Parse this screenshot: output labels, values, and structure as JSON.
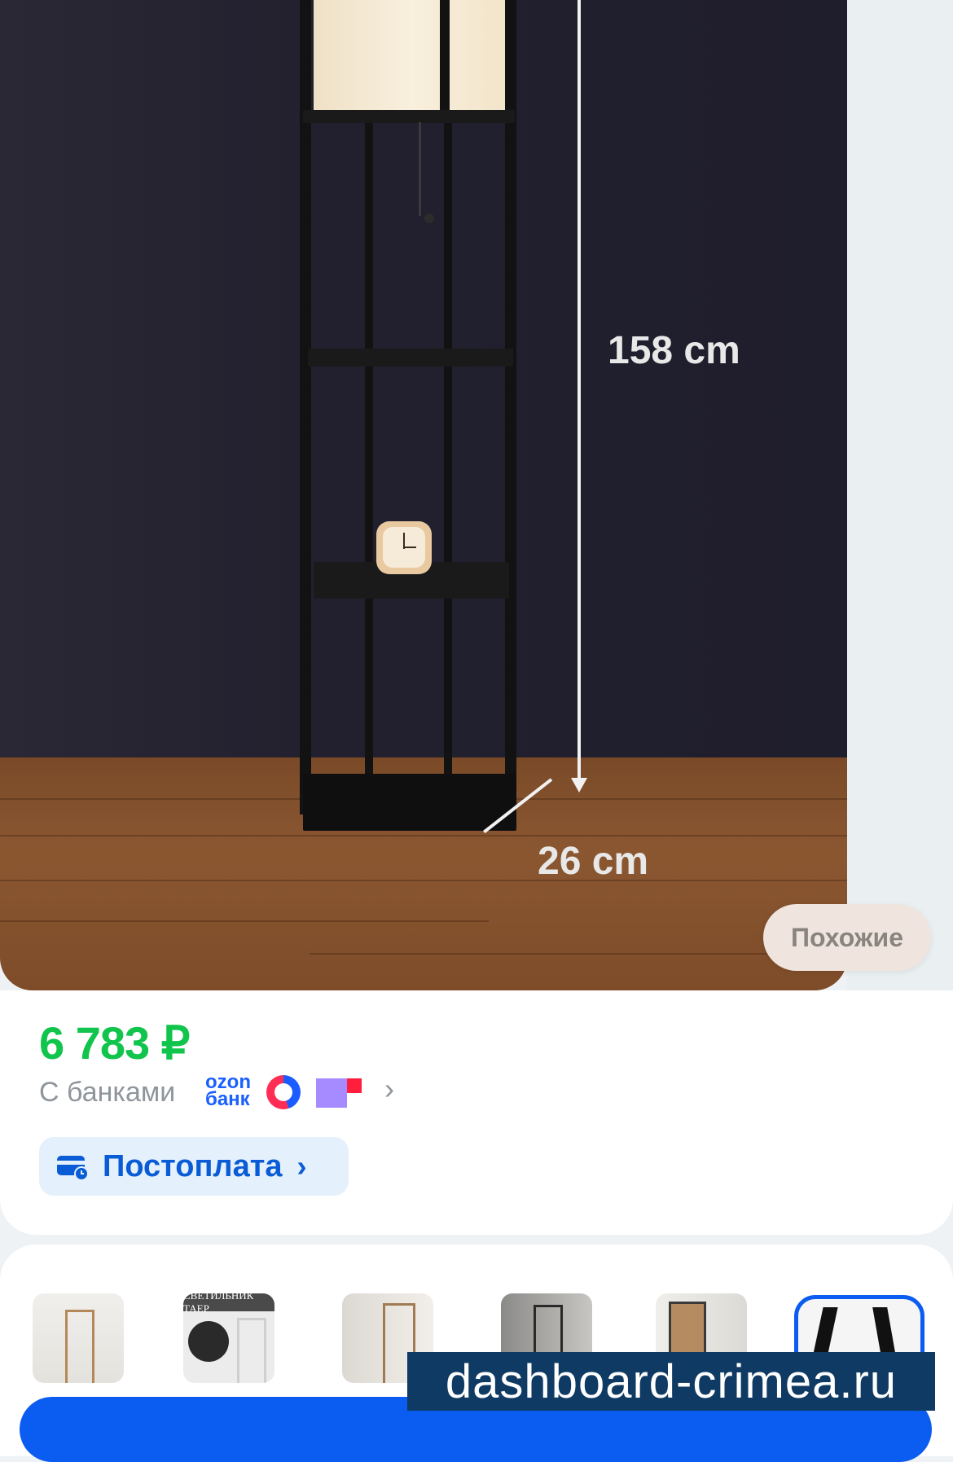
{
  "hero": {
    "height_dimension": "158 cm",
    "depth_dimension": "26 cm",
    "similar_button": "Похожие"
  },
  "price_card": {
    "price": "6 783 ₽",
    "banks_label": "С банками",
    "ozon_bank_logo": "ozon банк",
    "postpay_label": "Постоплата"
  },
  "thumbnails": {
    "count": 6,
    "selected_index": 5,
    "thumb_2_caption": "СВЕТИЛЬНИК ТАЕР"
  },
  "watermark": "dashboard-crimea.ru",
  "colors": {
    "price_green": "#10c44c",
    "accent_blue": "#0b5cf0",
    "postpay_bg": "#e4f0fb"
  }
}
